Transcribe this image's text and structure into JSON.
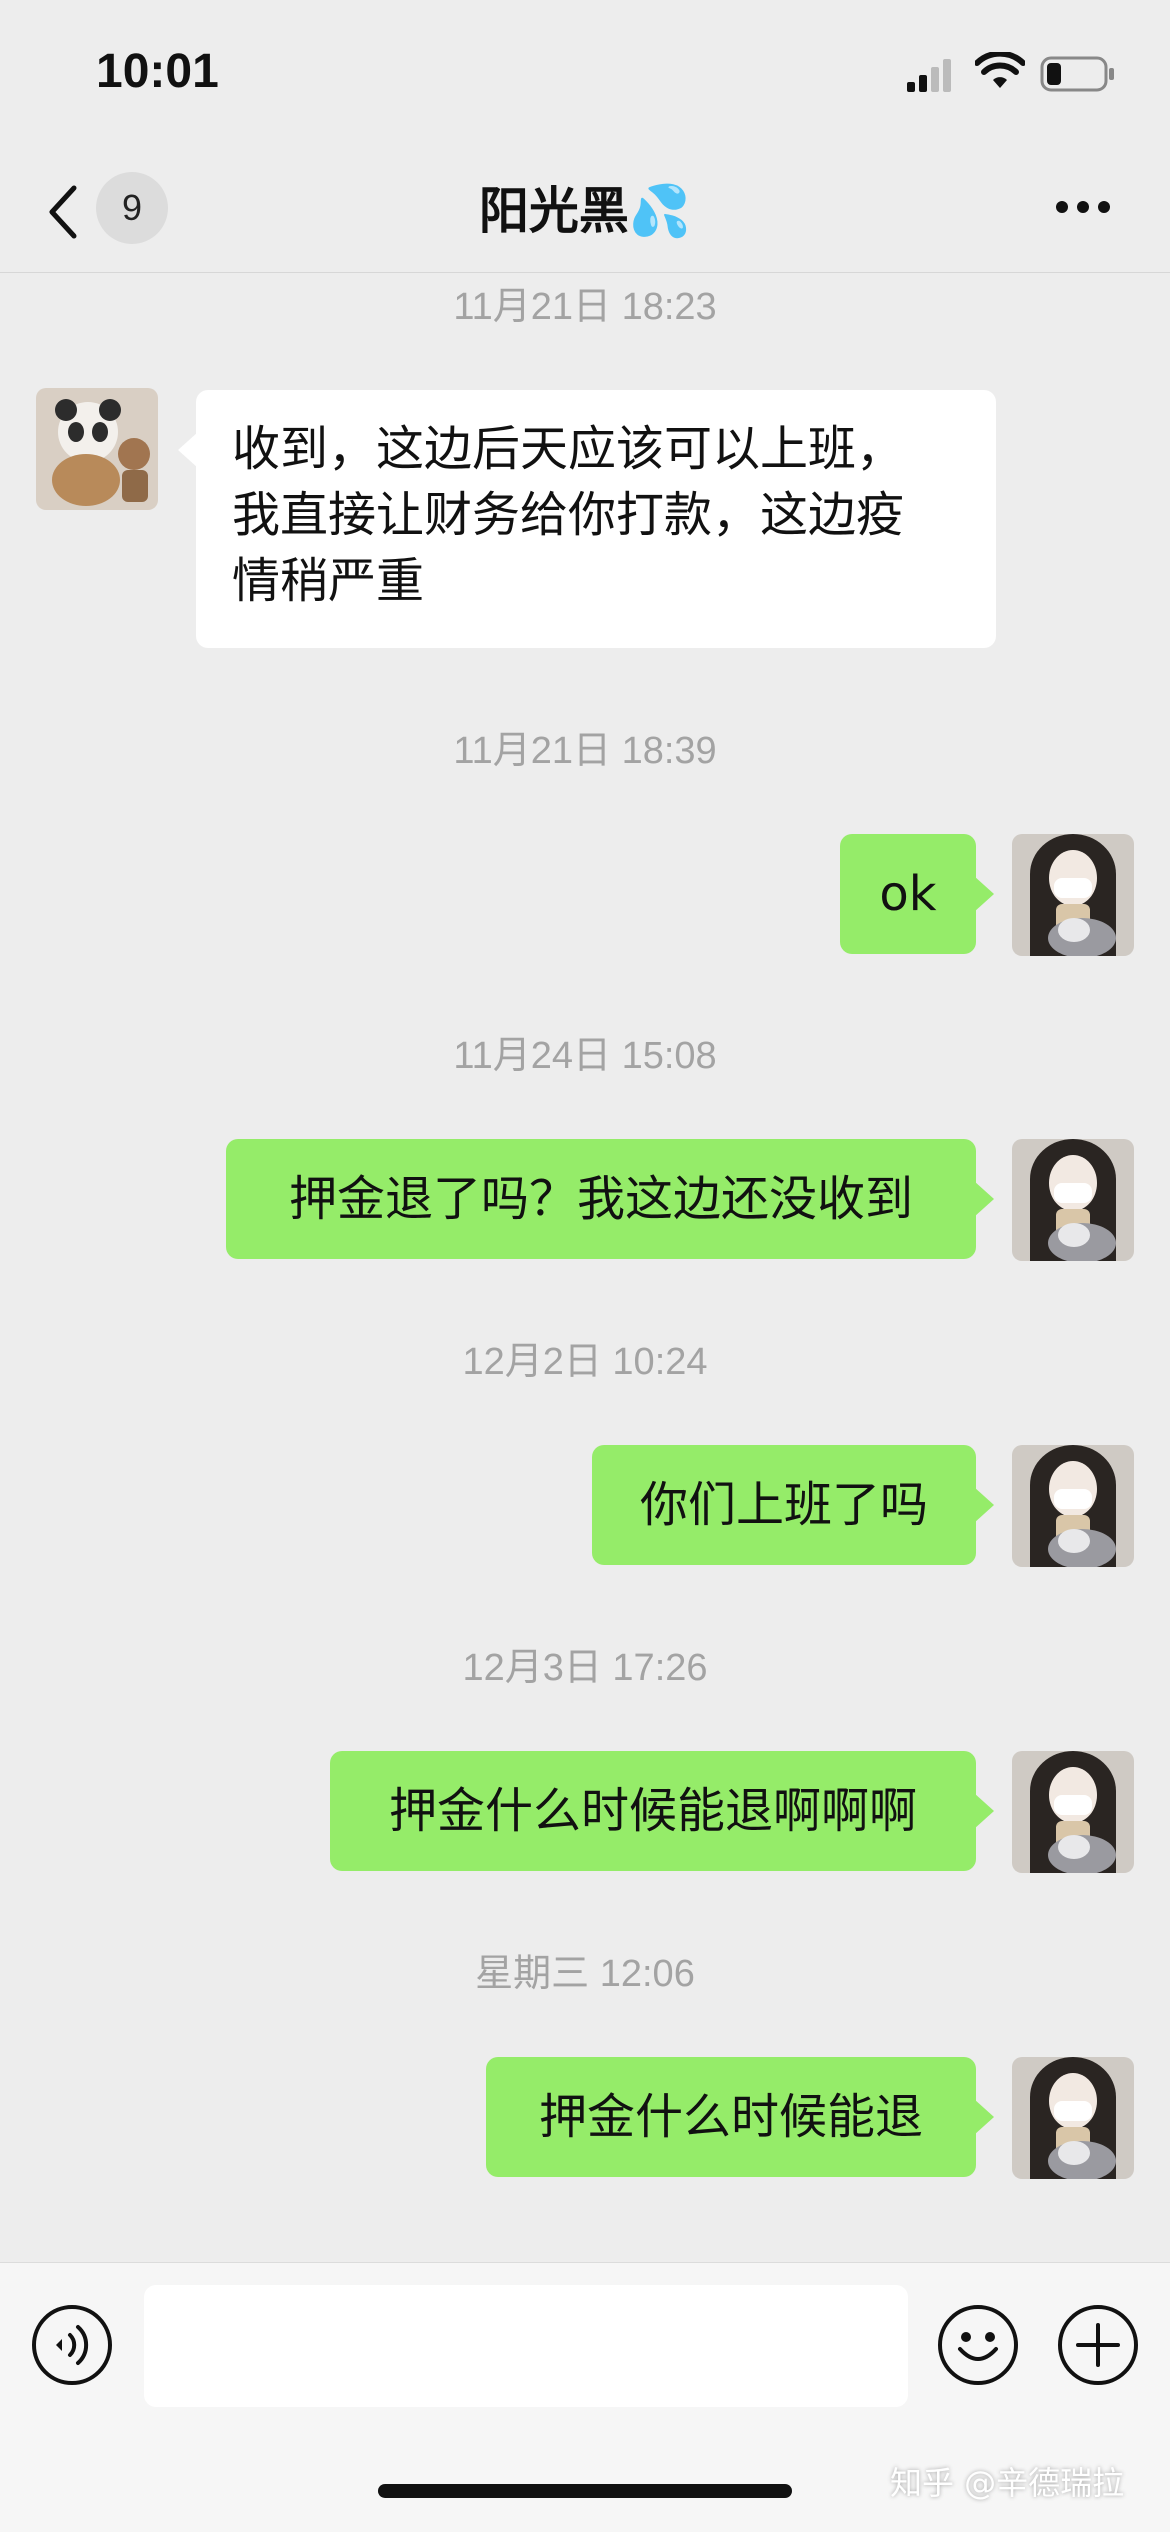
{
  "status_bar": {
    "time": "10:01"
  },
  "nav": {
    "unread_count": "9",
    "contact_name": "阳光黑",
    "name_emoji": "💦"
  },
  "messages": [
    {
      "timestamp": "11月21日 18:23",
      "direction": "in",
      "lines": [
        "收到，这边后天应该可以上班，",
        "我直接让财务给你打款，这边疫",
        "情稍严重"
      ]
    },
    {
      "timestamp": "11月21日 18:39",
      "direction": "out",
      "text": "ok"
    },
    {
      "timestamp": "11月24日 15:08",
      "direction": "out",
      "text": "押金退了吗？我这边还没收到"
    },
    {
      "timestamp": "12月2日 10:24",
      "direction": "out",
      "text": "你们上班了吗"
    },
    {
      "timestamp": "12月3日 17:26",
      "direction": "out",
      "text": "押金什么时候能退啊啊啊"
    },
    {
      "timestamp": "星期三 12:06",
      "direction": "out",
      "text": "押金什么时候能退"
    }
  ],
  "input": {
    "placeholder": ""
  },
  "watermark": "知乎 @辛德瑞拉",
  "colors": {
    "outgoing_bubble": "#95ec69",
    "incoming_bubble": "#ffffff",
    "background": "#ededed"
  },
  "icons": {
    "back": "chevron-left-icon",
    "more": "more-dots-icon",
    "voice": "voice-icon",
    "emoji": "emoji-icon",
    "plus": "plus-icon",
    "signal": "signal-icon",
    "wifi": "wifi-icon",
    "battery": "battery-icon"
  }
}
